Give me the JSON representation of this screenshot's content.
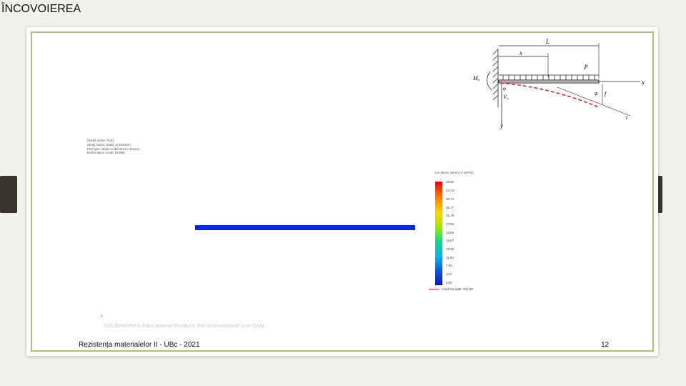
{
  "slide": {
    "title": "ÎNCOVOIEREA",
    "footer": "Rezistența materialelor II - UBc - 2021",
    "page_number": "12"
  },
  "diagram": {
    "labels": {
      "L": "L",
      "x": "x",
      "p": "p",
      "M0": "M₀",
      "V0": "V₀",
      "theta": "φ",
      "phi": "φ",
      "f": "f",
      "t": "t",
      "axis_x": "x",
      "axis_y": "y"
    },
    "colors": {
      "deflection_curve": "#d42020",
      "beam": "#222222"
    }
  },
  "simulation": {
    "info_lines": [
      "Model name: Part1",
      "Study name: Static 1(-Default-)",
      "Plot type: Static nodal stress Stress1",
      "Deformation scale: 29,686"
    ],
    "legend_title": "von Mises (N/mm^2 (MPa))",
    "legend_values": [
      "48,60",
      "43,72",
      "38,74",
      "35,77",
      "31,79",
      "27,82",
      "23,85",
      "19,87",
      "15,90",
      "11,92",
      "7,95",
      "3,97",
      "0,00"
    ],
    "yield_label": "Yield strength: 220,59",
    "watermark": "SOLIDWORKS Educational Product. For Instructional Use Only.",
    "axes_icon": "axes-triad-icon",
    "colors": {
      "beam": "#0a2ad6",
      "frame_border": "#a8c07a",
      "side_tab": "#3b3530"
    }
  }
}
